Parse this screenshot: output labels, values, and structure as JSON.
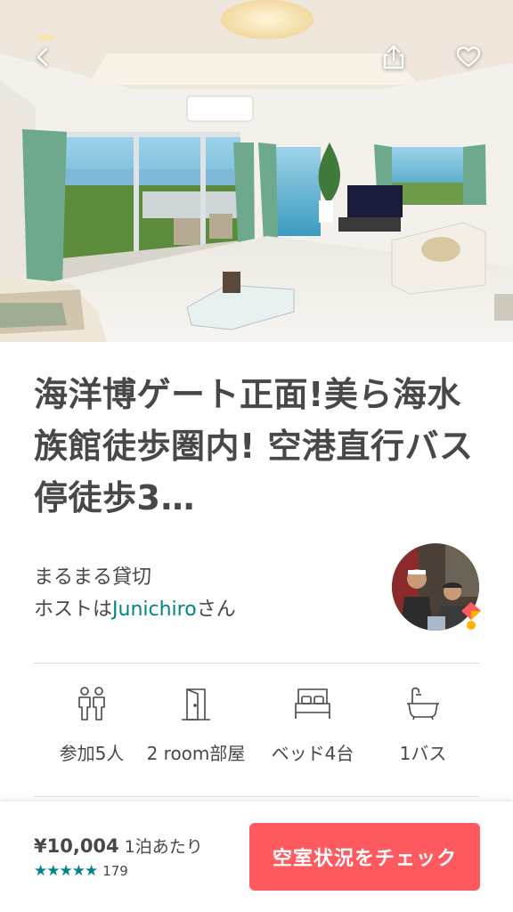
{
  "hero": {
    "photo_icon": "room-photo",
    "back_icon": "chevron-left-icon",
    "share_icon": "share-icon",
    "favorite_icon": "heart-icon"
  },
  "listing": {
    "title": "海洋博ゲート正面!美ら海水族館徒歩圏内! 空港直行バス停徒歩3…",
    "type": "まるまる貸切",
    "host_prefix": "ホストは",
    "host_name": "Junichiro",
    "host_suffix": "さん",
    "avatar_icon": "host-avatar"
  },
  "amenities": [
    {
      "icon": "guests-icon",
      "label": "参加5人"
    },
    {
      "icon": "door-icon",
      "label": "2 room部屋"
    },
    {
      "icon": "bed-icon",
      "label": "ベッド4台"
    },
    {
      "icon": "bathtub-icon",
      "label": "1バス"
    }
  ],
  "booking": {
    "price": "¥10,004",
    "per_night": "1泊あたり",
    "stars": "★★★★★",
    "review_count": "179",
    "cta_label": "空室状況をチェック"
  },
  "colors": {
    "accent": "#008489",
    "cta": "#ff5a5f",
    "text": "#484848",
    "divider": "#dddddd"
  }
}
